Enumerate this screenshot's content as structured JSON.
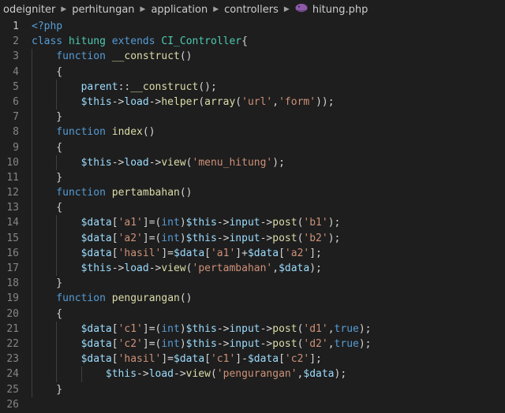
{
  "breadcrumb": {
    "items": [
      "odeigniter",
      "perhitungan",
      "application",
      "controllers",
      "hitung.php"
    ],
    "file_icon": "php-elephant-icon"
  },
  "editor": {
    "colors": {
      "keyword": "#569cd6",
      "function_name": "#dcdcaa",
      "variable": "#9cdcfe",
      "string": "#ce9178",
      "class_name": "#4ec9b0",
      "default": "#d4d4d4",
      "line_number": "#858585",
      "background": "#1e1e1e"
    },
    "lines": [
      {
        "n": "1",
        "indent": 0,
        "tokens": [
          {
            "t": "<?php",
            "c": "k"
          }
        ]
      },
      {
        "n": "2",
        "indent": 0,
        "tokens": [
          {
            "t": "class ",
            "c": "k"
          },
          {
            "t": "hitung ",
            "c": "c"
          },
          {
            "t": "extends ",
            "c": "k"
          },
          {
            "t": "CI_Controller",
            "c": "c"
          },
          {
            "t": "{",
            "c": "o"
          }
        ]
      },
      {
        "n": "3",
        "indent": 1,
        "tokens": [
          {
            "t": "function ",
            "c": "k"
          },
          {
            "t": "__construct",
            "c": "f"
          },
          {
            "t": "()",
            "c": "o"
          }
        ]
      },
      {
        "n": "4",
        "indent": 1,
        "tokens": [
          {
            "t": "{",
            "c": "o"
          }
        ]
      },
      {
        "n": "5",
        "indent": 2,
        "tokens": [
          {
            "t": "parent",
            "c": "v"
          },
          {
            "t": "::",
            "c": "o"
          },
          {
            "t": "__construct",
            "c": "f"
          },
          {
            "t": "();",
            "c": "o"
          }
        ]
      },
      {
        "n": "6",
        "indent": 2,
        "tokens": [
          {
            "t": "$this",
            "c": "v"
          },
          {
            "t": "->",
            "c": "o"
          },
          {
            "t": "load",
            "c": "v"
          },
          {
            "t": "->",
            "c": "o"
          },
          {
            "t": "helper",
            "c": "f"
          },
          {
            "t": "(",
            "c": "o"
          },
          {
            "t": "array",
            "c": "f"
          },
          {
            "t": "(",
            "c": "o"
          },
          {
            "t": "'url'",
            "c": "s"
          },
          {
            "t": ",",
            "c": "o"
          },
          {
            "t": "'form'",
            "c": "s"
          },
          {
            "t": "));",
            "c": "o"
          }
        ]
      },
      {
        "n": "7",
        "indent": 1,
        "tokens": [
          {
            "t": "}",
            "c": "o"
          }
        ]
      },
      {
        "n": "8",
        "indent": 1,
        "tokens": [
          {
            "t": "function ",
            "c": "k"
          },
          {
            "t": "index",
            "c": "f"
          },
          {
            "t": "()",
            "c": "o"
          }
        ]
      },
      {
        "n": "9",
        "indent": 1,
        "tokens": [
          {
            "t": "{",
            "c": "o"
          }
        ]
      },
      {
        "n": "10",
        "indent": 2,
        "tokens": [
          {
            "t": "$this",
            "c": "v"
          },
          {
            "t": "->",
            "c": "o"
          },
          {
            "t": "load",
            "c": "v"
          },
          {
            "t": "->",
            "c": "o"
          },
          {
            "t": "view",
            "c": "f"
          },
          {
            "t": "(",
            "c": "o"
          },
          {
            "t": "'menu_hitung'",
            "c": "s"
          },
          {
            "t": ");",
            "c": "o"
          }
        ]
      },
      {
        "n": "11",
        "indent": 1,
        "tokens": [
          {
            "t": "}",
            "c": "o"
          }
        ]
      },
      {
        "n": "12",
        "indent": 1,
        "tokens": [
          {
            "t": "function ",
            "c": "k"
          },
          {
            "t": "pertambahan",
            "c": "f"
          },
          {
            "t": "()",
            "c": "o"
          }
        ]
      },
      {
        "n": "13",
        "indent": 1,
        "tokens": [
          {
            "t": "{",
            "c": "o"
          }
        ]
      },
      {
        "n": "14",
        "indent": 2,
        "tokens": [
          {
            "t": "$data",
            "c": "v"
          },
          {
            "t": "[",
            "c": "o"
          },
          {
            "t": "'a1'",
            "c": "s"
          },
          {
            "t": "]=(",
            "c": "o"
          },
          {
            "t": "int",
            "c": "k"
          },
          {
            "t": ")",
            "c": "o"
          },
          {
            "t": "$this",
            "c": "v"
          },
          {
            "t": "->",
            "c": "o"
          },
          {
            "t": "input",
            "c": "v"
          },
          {
            "t": "->",
            "c": "o"
          },
          {
            "t": "post",
            "c": "f"
          },
          {
            "t": "(",
            "c": "o"
          },
          {
            "t": "'b1'",
            "c": "s"
          },
          {
            "t": ");",
            "c": "o"
          }
        ]
      },
      {
        "n": "15",
        "indent": 2,
        "tokens": [
          {
            "t": "$data",
            "c": "v"
          },
          {
            "t": "[",
            "c": "o"
          },
          {
            "t": "'a2'",
            "c": "s"
          },
          {
            "t": "]=(",
            "c": "o"
          },
          {
            "t": "int",
            "c": "k"
          },
          {
            "t": ")",
            "c": "o"
          },
          {
            "t": "$this",
            "c": "v"
          },
          {
            "t": "->",
            "c": "o"
          },
          {
            "t": "input",
            "c": "v"
          },
          {
            "t": "->",
            "c": "o"
          },
          {
            "t": "post",
            "c": "f"
          },
          {
            "t": "(",
            "c": "o"
          },
          {
            "t": "'b2'",
            "c": "s"
          },
          {
            "t": ");",
            "c": "o"
          }
        ]
      },
      {
        "n": "16",
        "indent": 2,
        "tokens": [
          {
            "t": "$data",
            "c": "v"
          },
          {
            "t": "[",
            "c": "o"
          },
          {
            "t": "'hasil'",
            "c": "s"
          },
          {
            "t": "]=",
            "c": "o"
          },
          {
            "t": "$data",
            "c": "v"
          },
          {
            "t": "[",
            "c": "o"
          },
          {
            "t": "'a1'",
            "c": "s"
          },
          {
            "t": "]+",
            "c": "o"
          },
          {
            "t": "$data",
            "c": "v"
          },
          {
            "t": "[",
            "c": "o"
          },
          {
            "t": "'a2'",
            "c": "s"
          },
          {
            "t": "];",
            "c": "o"
          }
        ]
      },
      {
        "n": "17",
        "indent": 2,
        "tokens": [
          {
            "t": "$this",
            "c": "v"
          },
          {
            "t": "->",
            "c": "o"
          },
          {
            "t": "load",
            "c": "v"
          },
          {
            "t": "->",
            "c": "o"
          },
          {
            "t": "view",
            "c": "f"
          },
          {
            "t": "(",
            "c": "o"
          },
          {
            "t": "'pertambahan'",
            "c": "s"
          },
          {
            "t": ",",
            "c": "o"
          },
          {
            "t": "$data",
            "c": "v"
          },
          {
            "t": ");",
            "c": "o"
          }
        ]
      },
      {
        "n": "18",
        "indent": 1,
        "tokens": [
          {
            "t": "}",
            "c": "o"
          }
        ]
      },
      {
        "n": "19",
        "indent": 1,
        "tokens": [
          {
            "t": "function ",
            "c": "k"
          },
          {
            "t": "pengurangan",
            "c": "f"
          },
          {
            "t": "()",
            "c": "o"
          }
        ]
      },
      {
        "n": "20",
        "indent": 1,
        "tokens": [
          {
            "t": "{",
            "c": "o"
          }
        ]
      },
      {
        "n": "21",
        "indent": 2,
        "tokens": [
          {
            "t": "$data",
            "c": "v"
          },
          {
            "t": "[",
            "c": "o"
          },
          {
            "t": "'c1'",
            "c": "s"
          },
          {
            "t": "]=(",
            "c": "o"
          },
          {
            "t": "int",
            "c": "k"
          },
          {
            "t": ")",
            "c": "o"
          },
          {
            "t": "$this",
            "c": "v"
          },
          {
            "t": "->",
            "c": "o"
          },
          {
            "t": "input",
            "c": "v"
          },
          {
            "t": "->",
            "c": "o"
          },
          {
            "t": "post",
            "c": "f"
          },
          {
            "t": "(",
            "c": "o"
          },
          {
            "t": "'d1'",
            "c": "s"
          },
          {
            "t": ",",
            "c": "o"
          },
          {
            "t": "true",
            "c": "k"
          },
          {
            "t": ");",
            "c": "o"
          }
        ]
      },
      {
        "n": "22",
        "indent": 2,
        "tokens": [
          {
            "t": "$data",
            "c": "v"
          },
          {
            "t": "[",
            "c": "o"
          },
          {
            "t": "'c2'",
            "c": "s"
          },
          {
            "t": "]=(",
            "c": "o"
          },
          {
            "t": "int",
            "c": "k"
          },
          {
            "t": ")",
            "c": "o"
          },
          {
            "t": "$this",
            "c": "v"
          },
          {
            "t": "->",
            "c": "o"
          },
          {
            "t": "input",
            "c": "v"
          },
          {
            "t": "->",
            "c": "o"
          },
          {
            "t": "post",
            "c": "f"
          },
          {
            "t": "(",
            "c": "o"
          },
          {
            "t": "'d2'",
            "c": "s"
          },
          {
            "t": ",",
            "c": "o"
          },
          {
            "t": "true",
            "c": "k"
          },
          {
            "t": ");",
            "c": "o"
          }
        ]
      },
      {
        "n": "23",
        "indent": 2,
        "tokens": [
          {
            "t": "$data",
            "c": "v"
          },
          {
            "t": "[",
            "c": "o"
          },
          {
            "t": "'hasil'",
            "c": "s"
          },
          {
            "t": "]=",
            "c": "o"
          },
          {
            "t": "$data",
            "c": "v"
          },
          {
            "t": "[",
            "c": "o"
          },
          {
            "t": "'c1'",
            "c": "s"
          },
          {
            "t": "]-",
            "c": "o"
          },
          {
            "t": "$data",
            "c": "v"
          },
          {
            "t": "[",
            "c": "o"
          },
          {
            "t": "'c2'",
            "c": "s"
          },
          {
            "t": "];",
            "c": "o"
          }
        ]
      },
      {
        "n": "24",
        "indent": 3,
        "tokens": [
          {
            "t": "$this",
            "c": "v"
          },
          {
            "t": "->",
            "c": "o"
          },
          {
            "t": "load",
            "c": "v"
          },
          {
            "t": "->",
            "c": "o"
          },
          {
            "t": "view",
            "c": "f"
          },
          {
            "t": "(",
            "c": "o"
          },
          {
            "t": "'pengurangan'",
            "c": "s"
          },
          {
            "t": ",",
            "c": "o"
          },
          {
            "t": "$data",
            "c": "v"
          },
          {
            "t": ");",
            "c": "o"
          }
        ]
      },
      {
        "n": "25",
        "indent": 1,
        "tokens": [
          {
            "t": "}",
            "c": "o"
          }
        ]
      },
      {
        "n": "26",
        "indent": 0,
        "tokens": []
      }
    ]
  }
}
